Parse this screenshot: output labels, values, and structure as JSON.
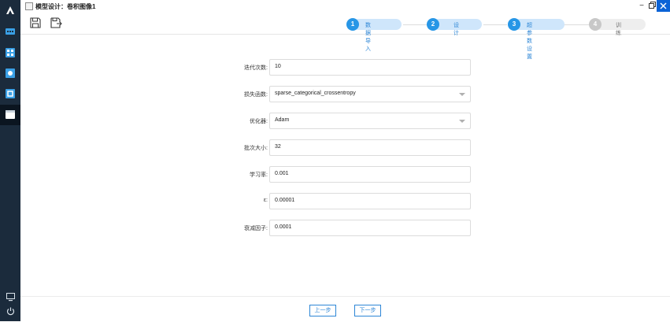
{
  "window": {
    "title": "模型设计：卷积图像1"
  },
  "steps": [
    {
      "num": "1",
      "label": "数据导入"
    },
    {
      "num": "2",
      "label": "设计"
    },
    {
      "num": "3",
      "label": "超参数设置"
    },
    {
      "num": "4",
      "label": "训练"
    }
  ],
  "form": [
    {
      "label": "迭代次数:",
      "value": "10"
    },
    {
      "label": "损失函数:",
      "value": "sparse_categorical_crossentropy"
    },
    {
      "label": "优化器:",
      "value": "Adam"
    },
    {
      "label": "批次大小:",
      "value": "32"
    },
    {
      "label": "学习率:",
      "value": "0.001"
    },
    {
      "label": "ε:",
      "value": "0.00001"
    },
    {
      "label": "衰减因子:",
      "value": "0.0001"
    }
  ],
  "footer": {
    "prev": "上一步",
    "next": "下一步"
  },
  "colors": {
    "accent": "#2796e6",
    "sidebar": "#1b2b3c",
    "close": "#0b63d6"
  }
}
